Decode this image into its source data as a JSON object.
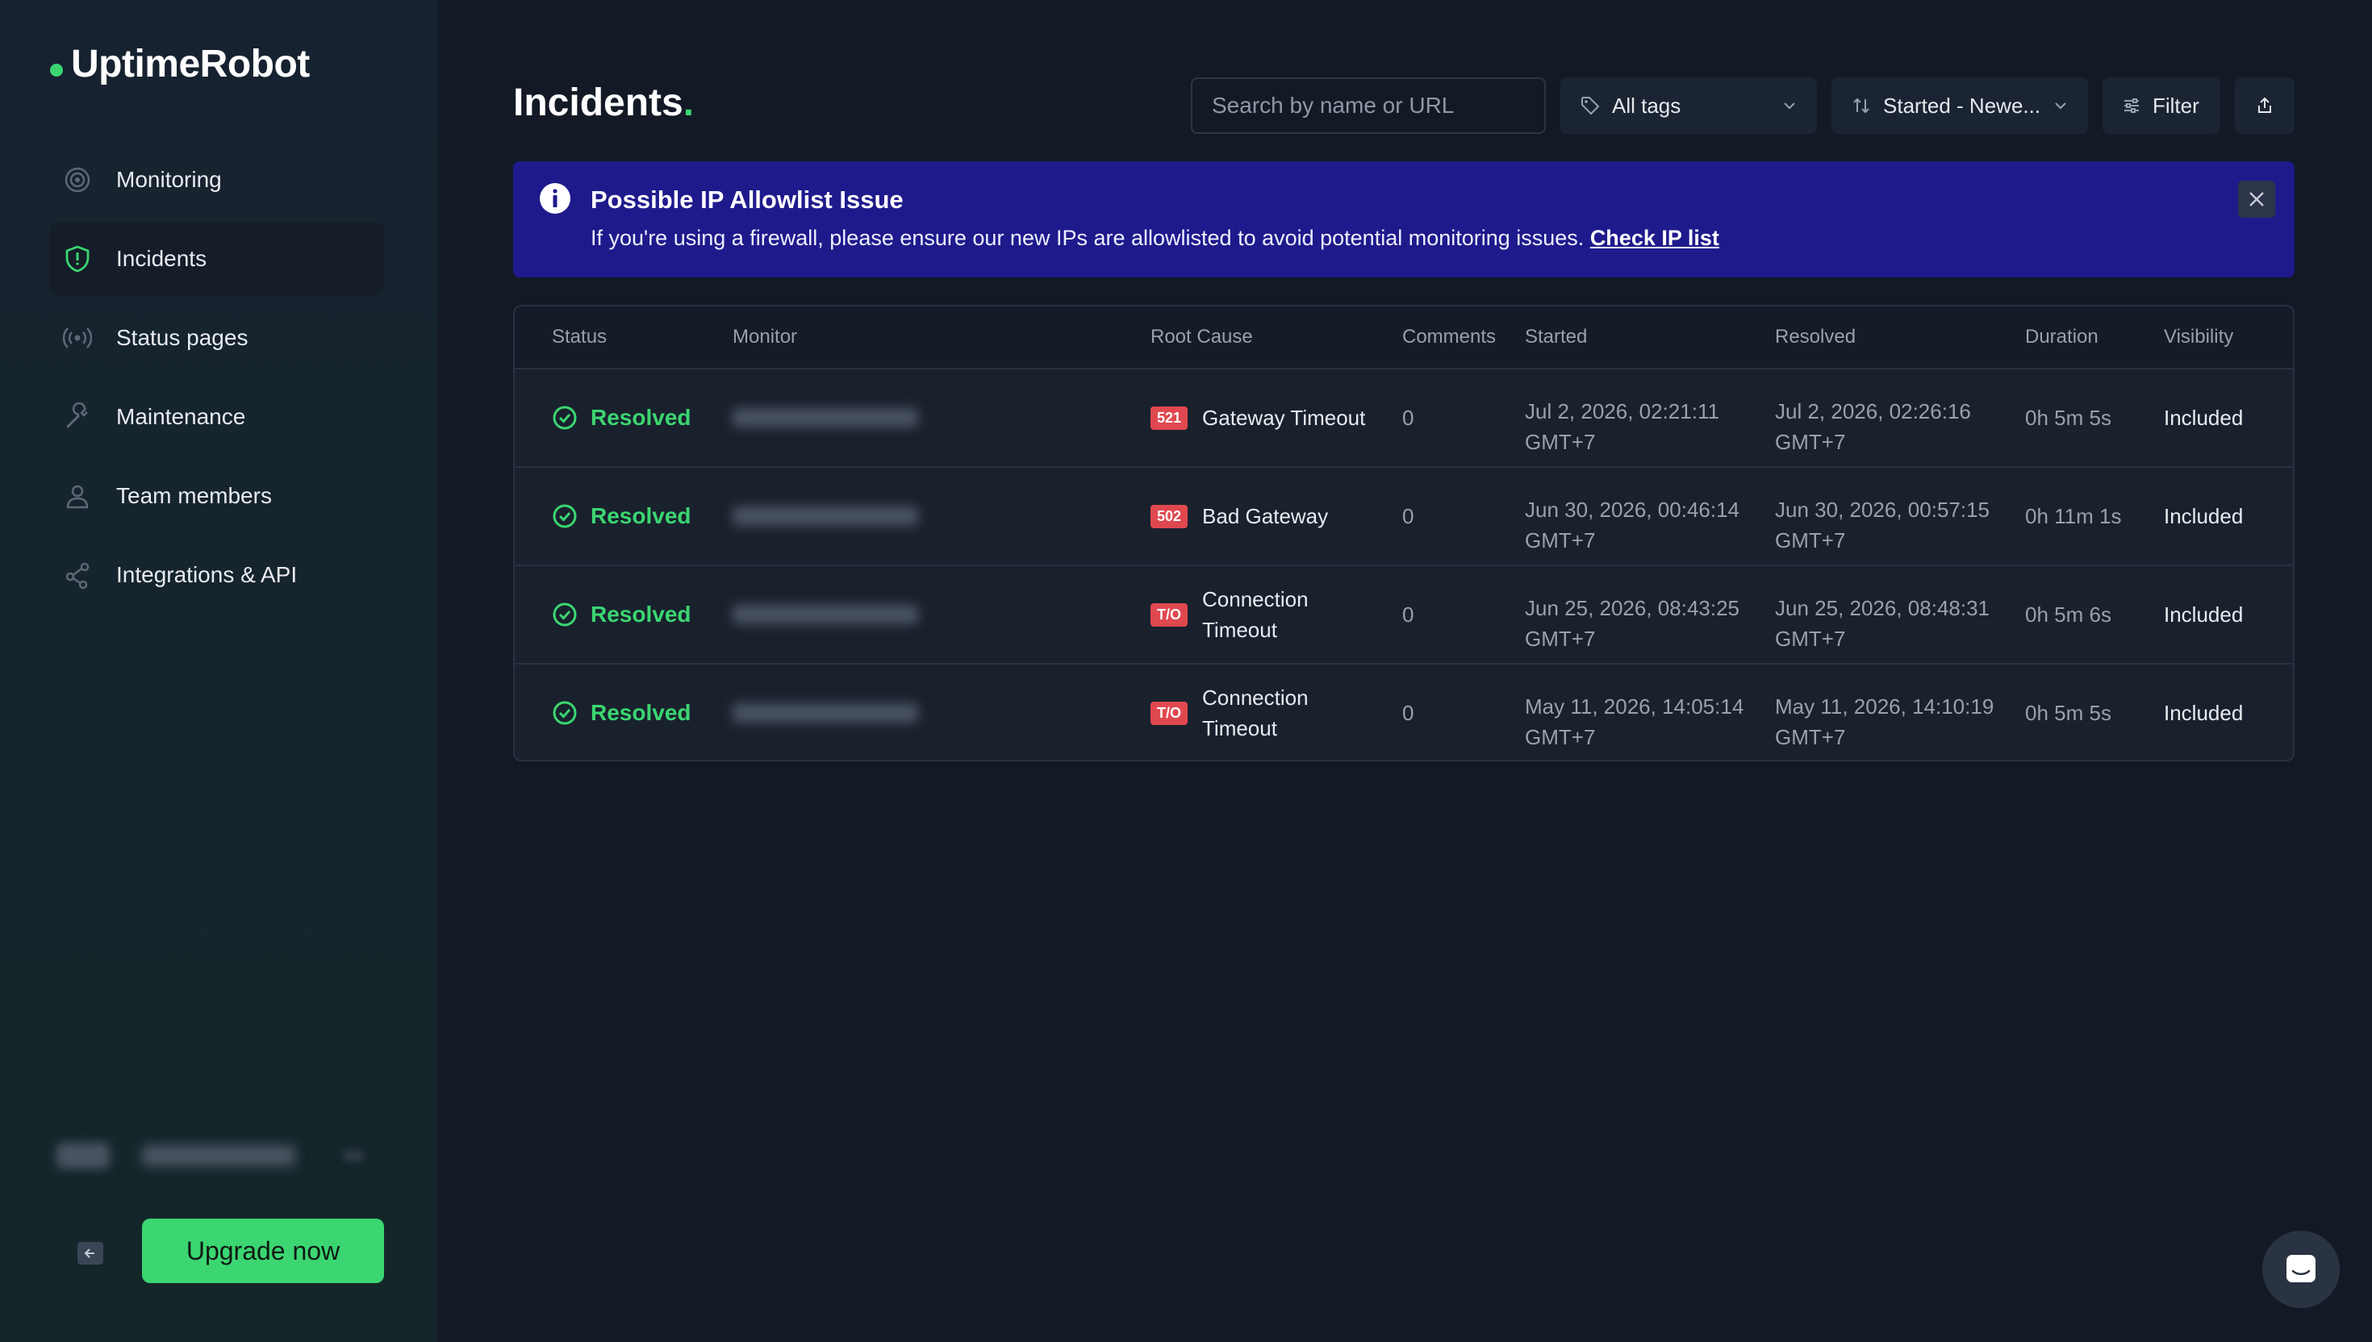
{
  "sidebar": {
    "logo": "UptimeRobot",
    "items": [
      {
        "label": "Monitoring"
      },
      {
        "label": "Incidents"
      },
      {
        "label": "Status pages"
      },
      {
        "label": "Maintenance"
      },
      {
        "label": "Team members"
      },
      {
        "label": "Integrations & API"
      }
    ],
    "upgrade_label": "Upgrade now"
  },
  "header": {
    "title": "Incidents",
    "title_dot": ".",
    "search_placeholder": "Search by name or URL",
    "tags_label": "All tags",
    "sort_label": "Started - Newe...",
    "filter_label": "Filter"
  },
  "banner": {
    "title": "Possible IP Allowlist Issue",
    "text": "If you're using a firewall, please ensure our new IPs are allowlisted to avoid potential monitoring issues. ",
    "link": "Check IP list"
  },
  "table": {
    "headers": [
      "Status",
      "Monitor",
      "Root Cause",
      "Comments",
      "Started",
      "Resolved",
      "Duration",
      "Visibility"
    ],
    "rows": [
      {
        "status": "Resolved",
        "badge": "521",
        "cause": "Gateway Timeout",
        "comments": "0",
        "started_date": "Jul 2, 2026, 02:21:11",
        "started_tz": "GMT+7",
        "resolved_date": "Jul 2, 2026, 02:26:16",
        "resolved_tz": "GMT+7",
        "duration": "0h 5m 5s",
        "visibility": "Included"
      },
      {
        "status": "Resolved",
        "badge": "502",
        "cause": "Bad Gateway",
        "comments": "0",
        "started_date": "Jun 30, 2026, 00:46:14",
        "started_tz": "GMT+7",
        "resolved_date": "Jun 30, 2026, 00:57:15",
        "resolved_tz": "GMT+7",
        "duration": "0h 11m 1s",
        "visibility": "Included"
      },
      {
        "status": "Resolved",
        "badge": "T/O",
        "cause": "Connection Timeout",
        "comments": "0",
        "started_date": "Jun 25, 2026, 08:43:25",
        "started_tz": "GMT+7",
        "resolved_date": "Jun 25, 2026, 08:48:31",
        "resolved_tz": "GMT+7",
        "duration": "0h 5m 6s",
        "visibility": "Included"
      },
      {
        "status": "Resolved",
        "badge": "T/O",
        "cause": "Connection Timeout",
        "comments": "0",
        "started_date": "May 11, 2026, 14:05:14",
        "started_tz": "GMT+7",
        "resolved_date": "May 11, 2026, 14:10:19",
        "resolved_tz": "GMT+7",
        "duration": "0h 5m 5s",
        "visibility": "Included"
      }
    ]
  },
  "colors": {
    "accent": "#3bd671",
    "banner": "#1f1a8c",
    "badge": "#e0484f",
    "background": "#131a26"
  },
  "icons": {
    "monitoring": "target-icon",
    "incidents": "shield-icon",
    "status_pages": "broadcast-icon",
    "maintenance": "wrench-icon",
    "team": "user-icon",
    "integrations": "share-icon"
  }
}
